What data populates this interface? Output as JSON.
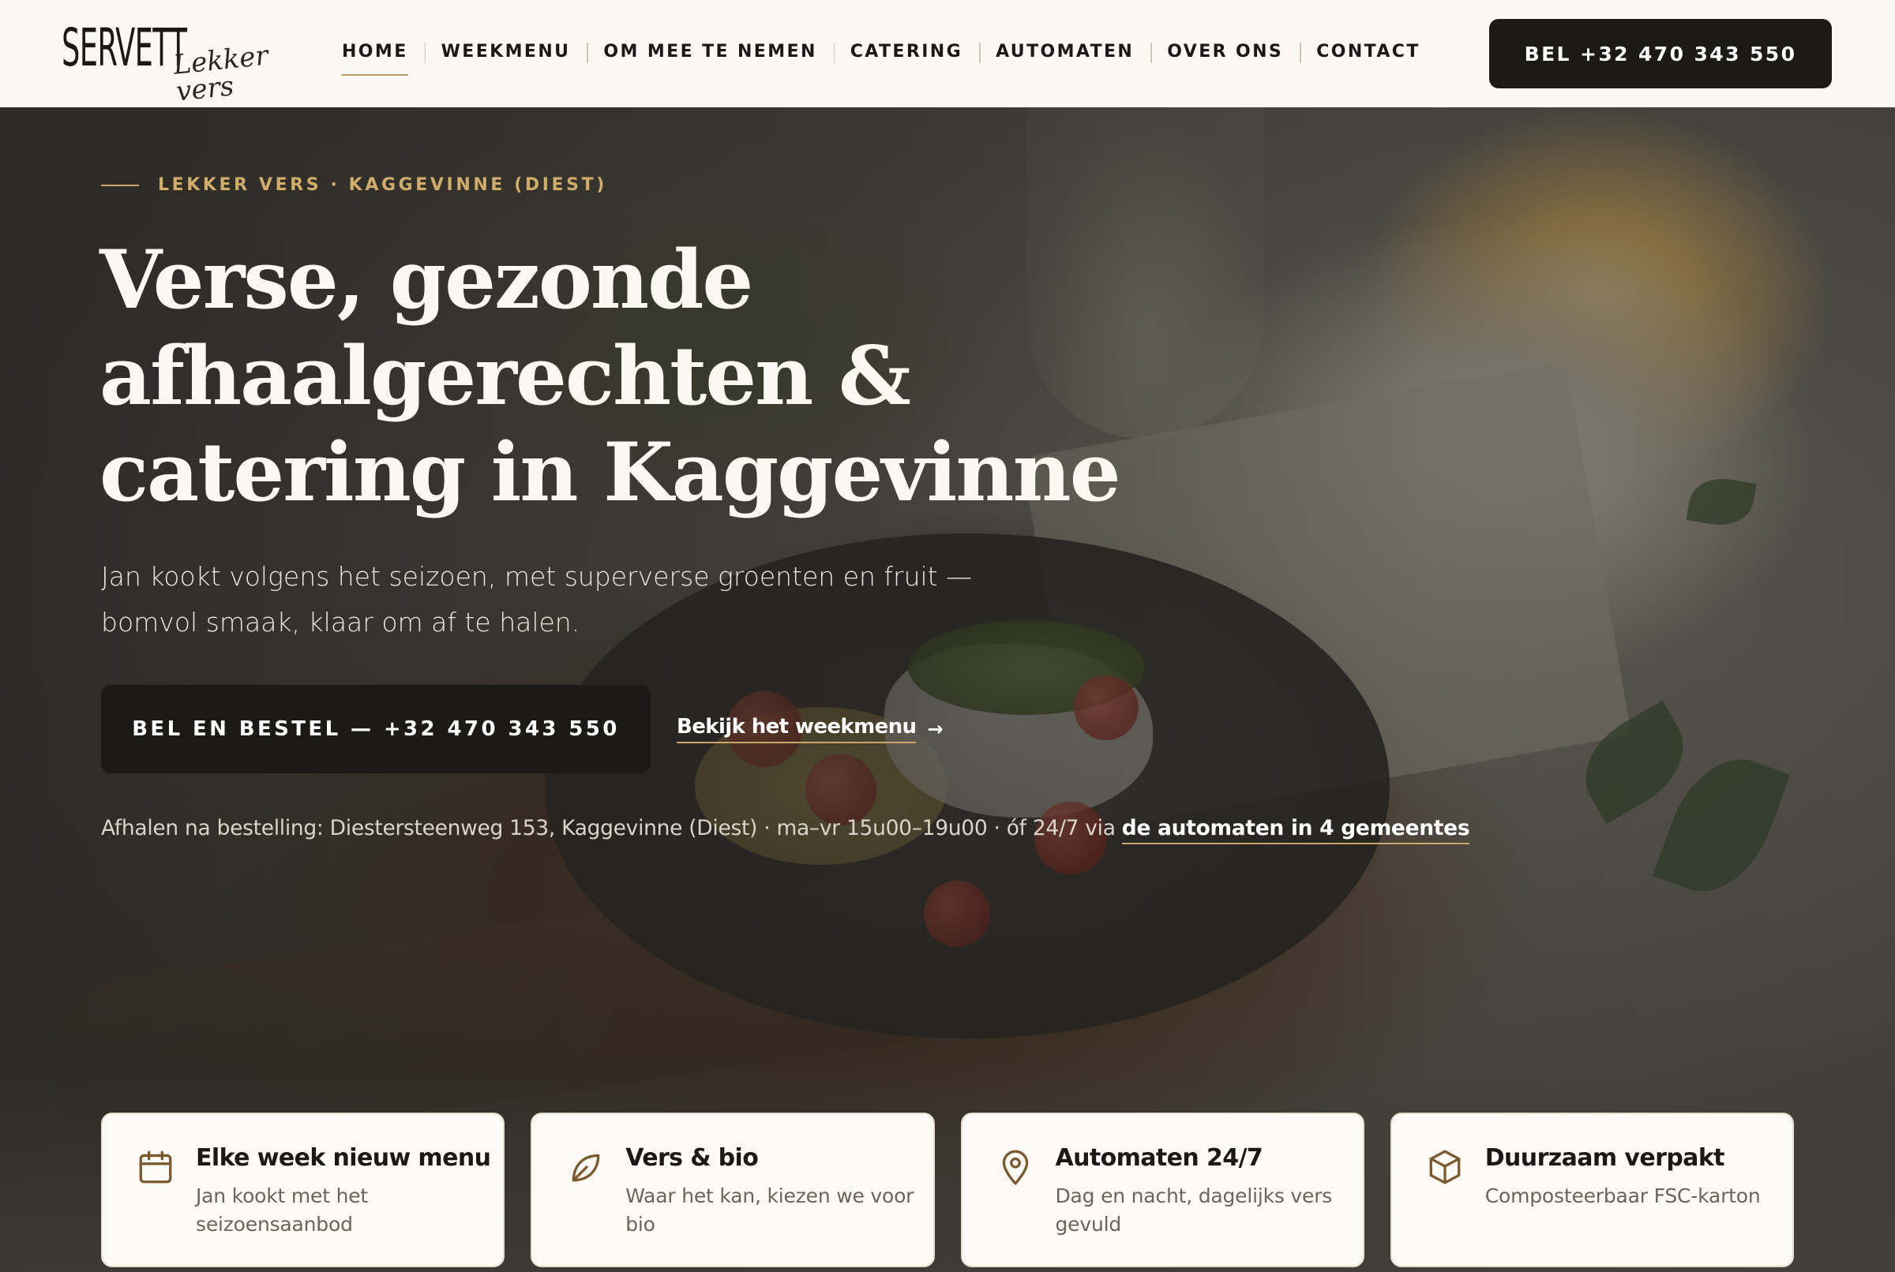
{
  "header": {
    "logo_main": "SERVETT",
    "logo_script": "Lekker vers",
    "nav": [
      {
        "label": "HOME",
        "active": true
      },
      {
        "label": "WEEKMENU",
        "active": false
      },
      {
        "label": "OM MEE TE NEMEN",
        "active": false
      },
      {
        "label": "CATERING",
        "active": false
      },
      {
        "label": "AUTOMATEN",
        "active": false
      },
      {
        "label": "OVER ONS",
        "active": false
      },
      {
        "label": "CONTACT",
        "active": false
      }
    ],
    "cta_label": "BEL +32 470 343 550"
  },
  "hero": {
    "eyebrow": "LEKKER VERS · KAGGEVINNE (DIEST)",
    "title_lines": [
      "Verse, gezonde",
      "afhaalgerechten &",
      "catering in Kaggevinne"
    ],
    "subtitle_lines": [
      "Jan kookt volgens het seizoen, met superverse groenten en fruit —",
      "bomvol smaak, klaar om af te halen."
    ],
    "cta_label": "BEL EN BESTEL — +32 470 343 550",
    "secondary_link": "Bekijk het weekmenu",
    "secondary_arrow": "→",
    "info_text": "Afhalen na bestelling: Diestersteenweg 153, Kaggevinne (Diest) · ma–vr 15u00–19u00 · óf 24/7 via ",
    "info_link": "de automaten in 4 gemeentes"
  },
  "features": [
    {
      "icon": "calendar-icon",
      "title": "Elke week nieuw menu",
      "desc_lines": [
        "Jan kookt met het",
        "seizoensaanbod"
      ]
    },
    {
      "icon": "leaf-icon",
      "title": "Vers & bio",
      "desc_lines": [
        "Waar het kan, kiezen we voor",
        "bio"
      ]
    },
    {
      "icon": "map-pin-icon",
      "title": "Automaten 24/7",
      "desc_lines": [
        "Dag en nacht, dagelijks vers",
        "gevuld"
      ]
    },
    {
      "icon": "box-icon",
      "title": "Duurzaam verpakt",
      "desc_lines": [
        "Composteerbaar FSC-karton"
      ]
    }
  ],
  "colors": {
    "dark": "#1c1a17",
    "accent": "#c9a76a",
    "background": "#faf8f3",
    "icon": "#7a5a2e"
  }
}
